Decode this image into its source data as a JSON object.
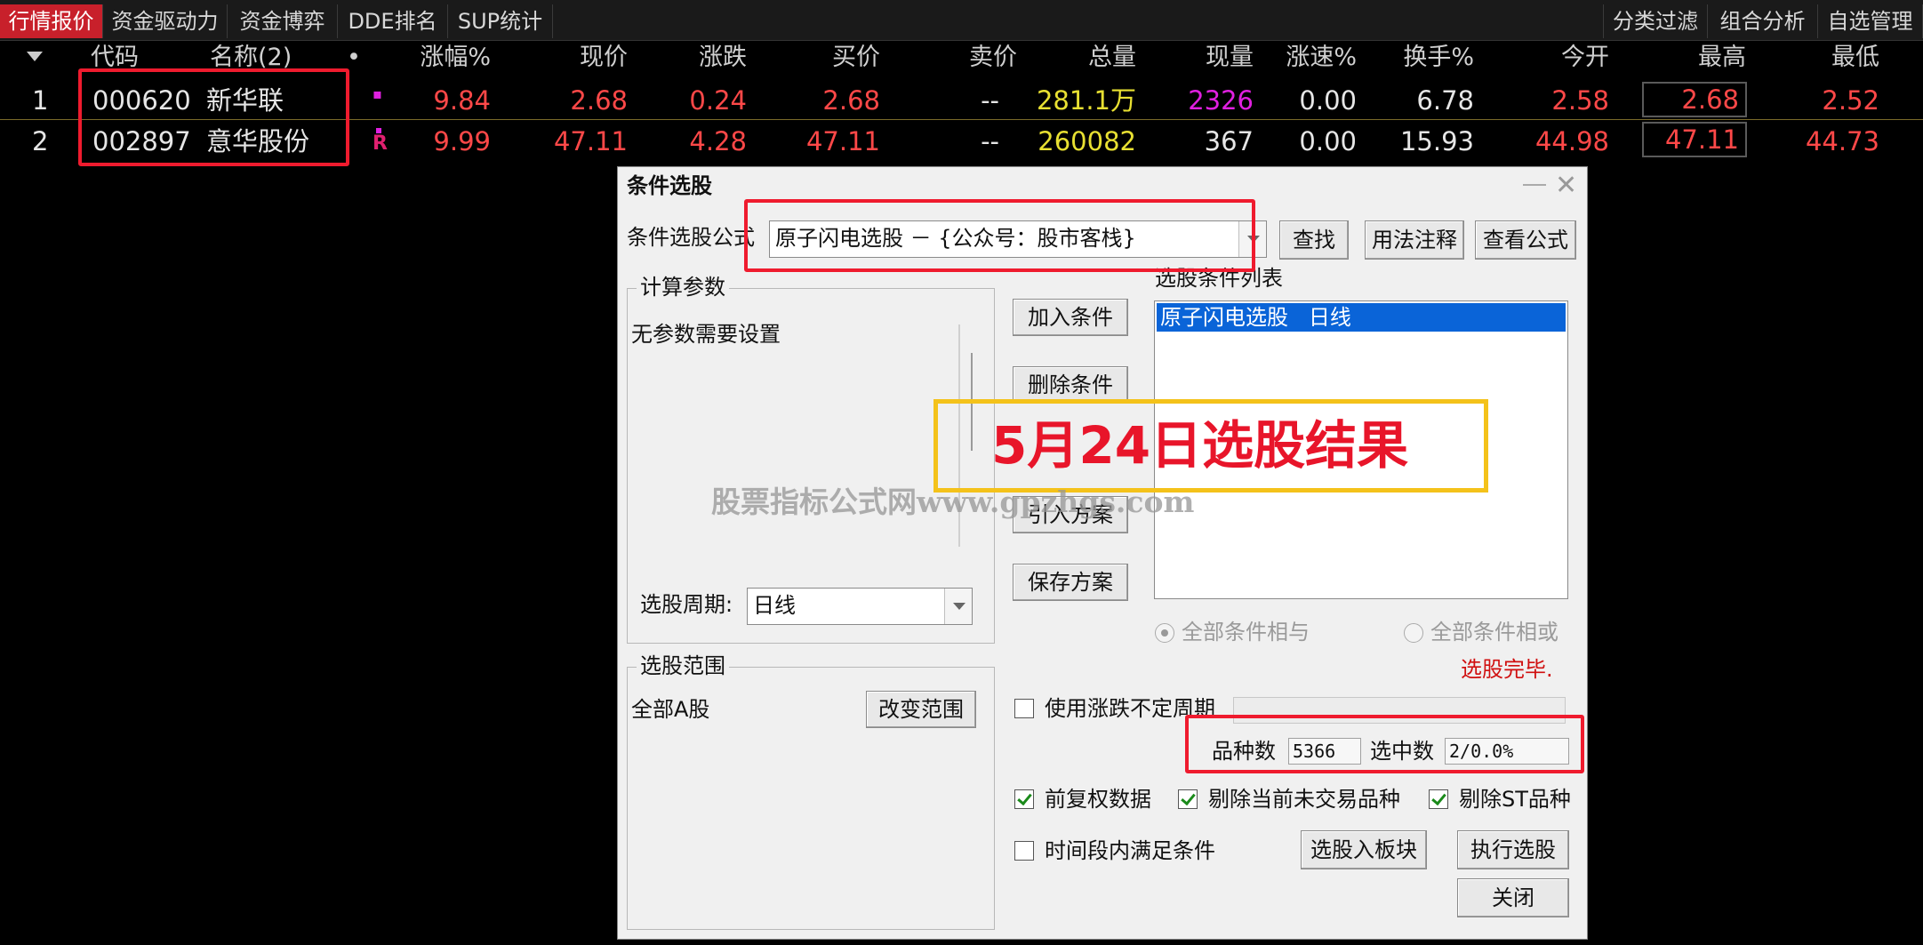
{
  "tabs": [
    {
      "label": "行情报价",
      "active": true
    },
    {
      "label": "资金驱动力",
      "active": false
    },
    {
      "label": "资金博弈",
      "active": false
    },
    {
      "label": "DDE排名",
      "active": false
    },
    {
      "label": "SUP统计",
      "active": false
    }
  ],
  "right_tabs": [
    "分类过滤",
    "组合分析",
    "自选管理"
  ],
  "columns": [
    "代码",
    "名称(2)",
    "•",
    "涨幅%",
    "现价",
    "涨跌",
    "买价",
    "卖价",
    "总量",
    "现量",
    "涨速%",
    "换手%",
    "今开",
    "最高",
    "最低"
  ],
  "rows": [
    {
      "no": "1",
      "code": "000620",
      "name": "新华联",
      "flag": "▪",
      "pct": "9.84",
      "price": "2.68",
      "chg": "0.24",
      "bid": "2.68",
      "ask": "--",
      "vol": "281.1万",
      "cur": "2326",
      "speed": "0.00",
      "turn": "6.78",
      "open": "2.58",
      "high": "2.68",
      "low": "2.52"
    },
    {
      "no": "2",
      "code": "002897",
      "name": "意华股份",
      "flag": "R",
      "pct": "9.99",
      "price": "47.11",
      "chg": "4.28",
      "bid": "47.11",
      "ask": "--",
      "vol": "260082",
      "cur": "367",
      "speed": "0.00",
      "turn": "15.93",
      "open": "44.98",
      "high": "47.11",
      "low": "44.73"
    }
  ],
  "dialog": {
    "title": "条件选股",
    "formula_label": "条件选股公式",
    "formula_value": "原子闪电选股  －  {公众号：股市客栈}",
    "find_button": "查找",
    "usage_button": "用法注释",
    "view_formula_button": "查看公式",
    "params_group": "计算参数",
    "no_params": "无参数需要设置",
    "period_label": "选股周期:",
    "period_value": "日线",
    "add_condition": "加入条件",
    "delete_condition": "删除条件",
    "import_scheme": "引入方案",
    "save_scheme": "保存方案",
    "conditions_list_label": "选股条件列表",
    "conditions": [
      "原子闪电选股   日线"
    ],
    "all_and": "全部条件相与",
    "all_or": "全部条件相或",
    "status": "选股完毕.",
    "range_group": "选股范围",
    "range_value": "全部A股",
    "change_range": "改变范围",
    "use_uncertain_period": "使用涨跌不定周期",
    "variety_count_label": "品种数",
    "variety_count": "5366",
    "selected_count_label": "选中数",
    "selected_count": "2/0.0%",
    "forward_adjust": "前复权数据",
    "exclude_non_trading": "剔除当前未交易品种",
    "exclude_st": "剔除ST品种",
    "time_period_satisfy": "时间段内满足条件",
    "to_sector": "选股入板块",
    "execute": "执行选股",
    "close": "关闭"
  },
  "overlay_text": "5月24日选股结果",
  "watermark": "股票指标公式网www.gpzhgs.com",
  "colors": {
    "up_red": "#ff4848",
    "volume_yellow": "#e8e032",
    "current_magenta": "#e020e0",
    "highlight_red": "#ef1b2e",
    "banner_yellow": "#f4c21a",
    "selection_blue": "#0a64d8"
  }
}
